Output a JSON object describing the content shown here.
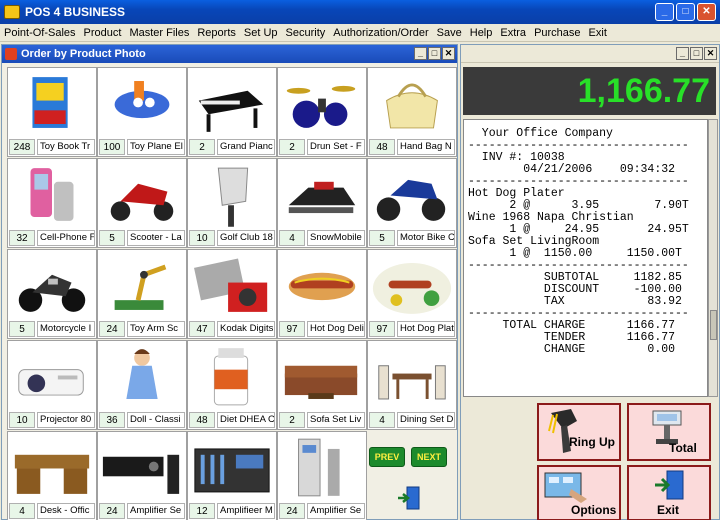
{
  "window": {
    "title": "POS 4 BUSINESS",
    "min": "_",
    "max": "□",
    "close": "✕"
  },
  "menu": [
    "Point-Of-Sales",
    "Product",
    "Master Files",
    "Reports",
    "Set Up",
    "Security",
    "Authorization/Order",
    "Save",
    "Help",
    "Extra",
    "Purchase",
    "Exit"
  ],
  "order_window": {
    "title": "Order by Product Photo",
    "min": "_",
    "max": "□",
    "close": "✕"
  },
  "products": [
    {
      "qty": "248",
      "name": "Toy Book Tr",
      "icon": "toy-book-icon"
    },
    {
      "qty": "100",
      "name": "Toy Plane El",
      "icon": "toy-plane-icon"
    },
    {
      "qty": "2",
      "name": "Grand Pianc",
      "icon": "piano-icon"
    },
    {
      "qty": "2",
      "name": "Drun Set - F",
      "icon": "drum-set-icon"
    },
    {
      "qty": "48",
      "name": "Hand Bag N",
      "icon": "handbag-icon"
    },
    {
      "qty": "32",
      "name": "Cell-Phone F",
      "icon": "cellphone-icon"
    },
    {
      "qty": "5",
      "name": "Scooter - La",
      "icon": "scooter-icon"
    },
    {
      "qty": "10",
      "name": "Golf Club 18",
      "icon": "golf-club-icon"
    },
    {
      "qty": "4",
      "name": "SnowMobile",
      "icon": "snowmobile-icon"
    },
    {
      "qty": "5",
      "name": "Motor Bike C",
      "icon": "atv-icon"
    },
    {
      "qty": "5",
      "name": "Motorcycle I",
      "icon": "motorcycle-icon"
    },
    {
      "qty": "24",
      "name": "Toy Arm Sc",
      "icon": "toy-arm-icon"
    },
    {
      "qty": "47",
      "name": "Kodak Digits",
      "icon": "camera-icon"
    },
    {
      "qty": "97",
      "name": "Hot Dog Deli",
      "icon": "hotdog-icon"
    },
    {
      "qty": "97",
      "name": "Hot Dog Plat",
      "icon": "hotdog-plate-icon"
    },
    {
      "qty": "10",
      "name": "Projector 80",
      "icon": "projector-icon"
    },
    {
      "qty": "36",
      "name": "Doll - Classi",
      "icon": "doll-icon"
    },
    {
      "qty": "48",
      "name": "Diet DHEA C",
      "icon": "supplement-bottle-icon"
    },
    {
      "qty": "2",
      "name": "Sofa Set Liv",
      "icon": "sofa-icon"
    },
    {
      "qty": "4",
      "name": "Dining Set D",
      "icon": "dining-set-icon"
    },
    {
      "qty": "4",
      "name": "Desk - Offic",
      "icon": "desk-icon"
    },
    {
      "qty": "24",
      "name": "Amplifier Se",
      "icon": "amplifier-icon"
    },
    {
      "qty": "12",
      "name": "Amplifieer M",
      "icon": "mixer-icon"
    },
    {
      "qty": "24",
      "name": "Amplifier Se",
      "icon": "amplifier-tower-icon"
    }
  ],
  "nav": {
    "prev": "PREV",
    "next": "NEXT"
  },
  "total_display": "1,166.77",
  "receipt": [
    "  Your Office Company",
    "--------------------------------",
    "  INV #: 10038",
    "        04/21/2006    09:34:32",
    "--------------------------------",
    "Hot Dog Plater",
    "      2 @      3.95        7.90T",
    "Wine 1968 Napa Christian",
    "      1 @     24.95       24.95T",
    "Sofa Set LivingRoom",
    "      1 @  1150.00     1150.00T",
    "--------------------------------",
    "           SUBTOTAL     1182.85",
    "           DISCOUNT     -100.00",
    "           TAX            83.92",
    "--------------------------------",
    "     TOTAL CHARGE      1166.77",
    "           TENDER      1166.77",
    "           CHANGE         0.00"
  ],
  "actions": {
    "ring_up": "Ring Up",
    "total": "Total",
    "options": "Options",
    "exit": "Exit"
  },
  "colors": {
    "display_bg": "#3a3a3a",
    "display_fg": "#28e028",
    "action_border": "#8b1a1a",
    "action_bg": "#fbdada"
  }
}
